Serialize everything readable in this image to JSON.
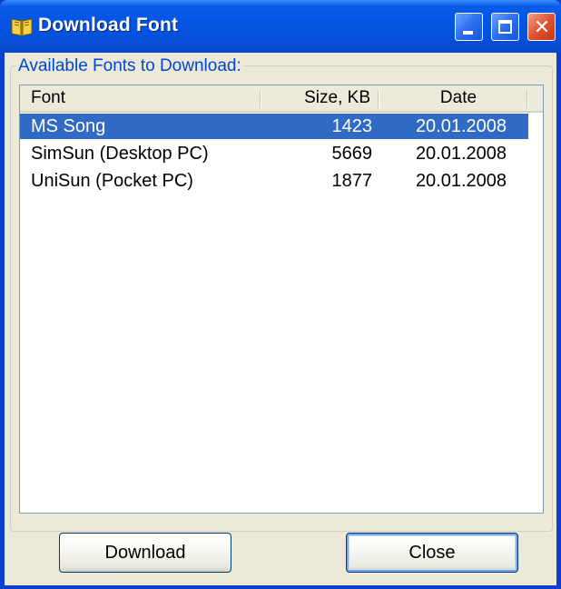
{
  "window": {
    "title": "Download Font",
    "icon": "book-icon",
    "controls": [
      "minimize-icon",
      "maximize-icon",
      "close-icon"
    ]
  },
  "group": {
    "label": "Available Fonts to Download:"
  },
  "list": {
    "columns": [
      "Font",
      "Size, KB",
      "Date"
    ],
    "rows": [
      {
        "name": "MS Song",
        "size": "1423",
        "date": "20.01.2008",
        "selected": true
      },
      {
        "name": "SimSun (Desktop PC)",
        "size": "5669",
        "date": "20.01.2008",
        "selected": false
      },
      {
        "name": "UniSun (Pocket PC)",
        "size": "1877",
        "date": "20.01.2008",
        "selected": false
      }
    ]
  },
  "buttons": {
    "download_label": "Download",
    "close_label": "Close"
  },
  "colors": {
    "titlebar": "#0554e3",
    "selection": "#316ac5",
    "group_label": "#0046d5",
    "dialog_bg": "#ece9d8"
  }
}
